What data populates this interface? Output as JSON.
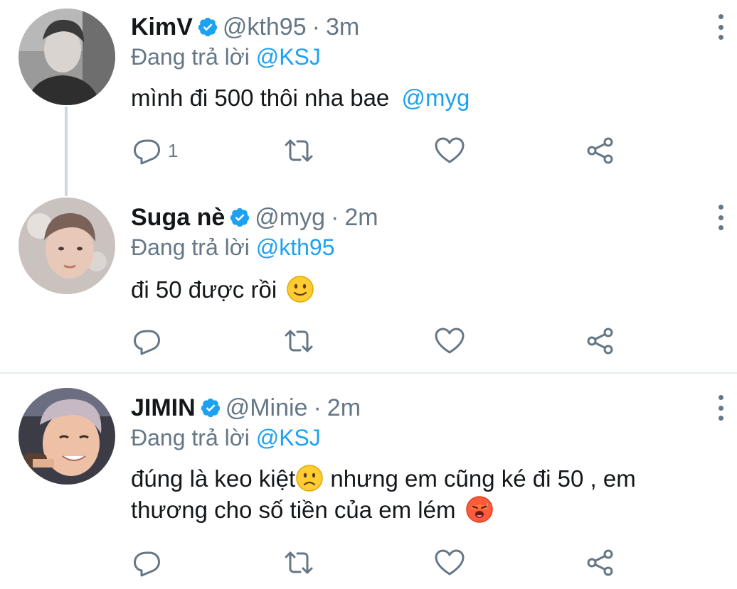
{
  "colors": {
    "accent": "#1da1f2",
    "secondary": "#657786",
    "text": "#14171a",
    "divider": "#e6ecf0"
  },
  "tweets": [
    {
      "name": "KimV",
      "handle": "@kth95",
      "sep": "·",
      "time": "3m",
      "reply_prefix": "Đang trả lời ",
      "reply_to": "@KSJ",
      "text": "mình đi 500 thôi nha bae ",
      "mention": "@myg",
      "reply_count": "1"
    },
    {
      "name": "Suga nè",
      "handle": "@myg",
      "sep": "·",
      "time": "2m",
      "reply_prefix": "Đang trả lời ",
      "reply_to": "@kth95",
      "text": "đi 50 được rồi",
      "emoji": "slightly-smiling-face",
      "reply_count": ""
    },
    {
      "name": "JIMIN",
      "handle": "@Minie",
      "sep": "·",
      "time": "2m",
      "reply_prefix": "Đang trả lời ",
      "reply_to": "@KSJ",
      "text_part1": "đúng là keo kiệt",
      "emoji1": "slightly-frowning-face",
      "text_part2": " nhưng em cũng ké đi 50 , em",
      "text_line2": "thương cho số tiền của em lém ",
      "emoji2": "hot-face",
      "reply_count": ""
    }
  ]
}
